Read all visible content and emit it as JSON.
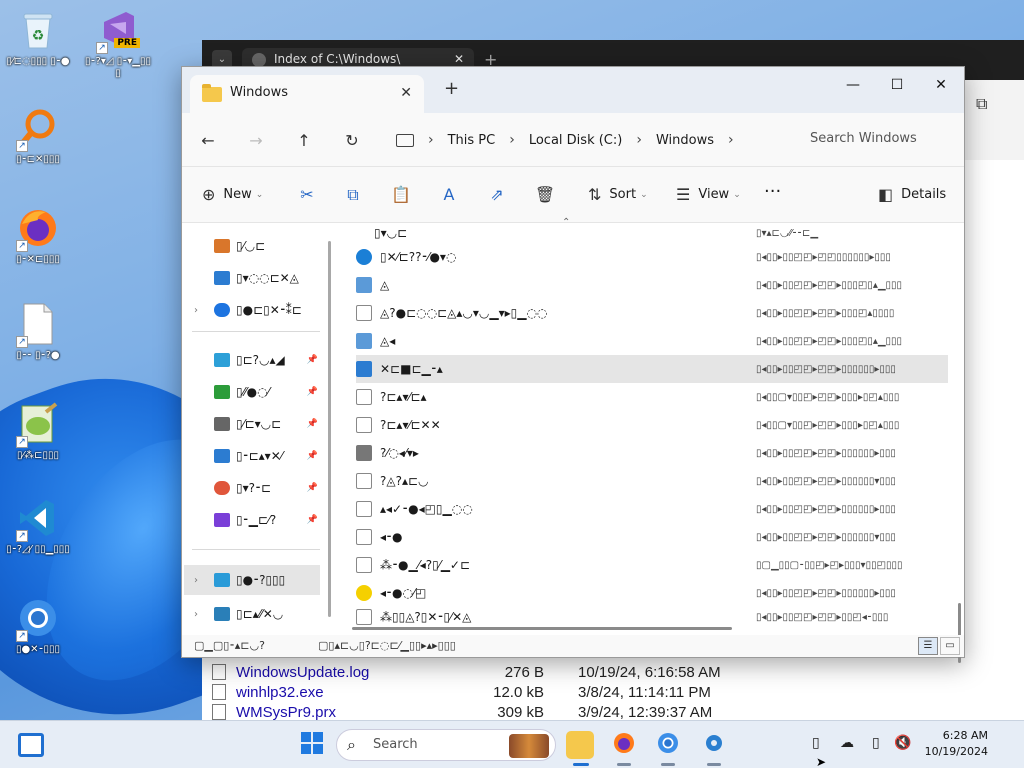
{
  "desktop": {
    "icons": [
      {
        "name": "recycle-bin",
        "label": "▯⁄⊏◌▯▯▯ ▯⁃●"
      },
      {
        "name": "visual-studio-pre",
        "label": "▯⁃?▾◿ ▯⁃▾▁▯▯▯",
        "badge": "PRE"
      },
      {
        "name": "search-everything",
        "label": "▯⁃⊏✕▯▯▯"
      },
      {
        "name": "firefox",
        "label": "▯⁃✕⊏▯▯▯"
      },
      {
        "name": "blank-file",
        "label": "▯⁃⁃ ▯⁃?●"
      },
      {
        "name": "notepad-plus",
        "label": "▯⁄⁂⊏▯▯▯"
      },
      {
        "name": "vscode",
        "label": "▯⁃?◿⁄ ▯▯▁▯▯▯"
      },
      {
        "name": "chrome",
        "label": "▯●✕⁃▯▯▯"
      }
    ]
  },
  "browser": {
    "tab_title": "Index of C:\\Windows\\",
    "files": [
      {
        "name": "WindowsUpdate.log",
        "size": "276 B",
        "date": "10/19/24, 6:16:58 AM"
      },
      {
        "name": "winhlp32.exe",
        "size": "12.0 kB",
        "date": "3/8/24, 11:14:11 PM"
      },
      {
        "name": "WMSysPr9.prx",
        "size": "309 kB",
        "date": "3/9/24, 12:39:37 AM"
      }
    ]
  },
  "explorer": {
    "tab_title": "Windows",
    "breadcrumb": [
      "This PC",
      "Local Disk (C:)",
      "Windows"
    ],
    "search_placeholder": "Search Windows",
    "commands": {
      "new": "New",
      "sort": "Sort",
      "view": "View",
      "more": "···",
      "details": "Details"
    },
    "nav": [
      {
        "label": "▯⁄◡⊏",
        "color": "#d9762b"
      },
      {
        "label": "▯▾◌◌⊏✕◬",
        "color": "#2c7cd1"
      },
      {
        "label": "▯●⊏▯✕⁃⁑⊏",
        "color": "#1d74e0"
      },
      {
        "label": "▯⊏?◡▴◢",
        "color": "#2da0d8"
      },
      {
        "label": "▯⁄⁄●◌⁄",
        "color": "#2c9c3a"
      },
      {
        "label": "▯⁄⊏▾◡⊏",
        "color": "#666"
      },
      {
        "label": "▯⁃⊏▴▾✕⁄",
        "color": "#2c7cd1"
      },
      {
        "label": "▯▾?⁃⊏",
        "color": "#e0563b"
      },
      {
        "label": "▯⁃▁⊏⁄?",
        "color": "#7a3fd8"
      },
      {
        "label": "▯●⁃?▯▯▯",
        "color": "#2a9bd8"
      },
      {
        "label": "▯⊏▴⁄⁄✕◡",
        "color": "#2a7fb8"
      }
    ],
    "files": [
      {
        "name": "▯▾◡⊏",
        "details": "▯▾▴⊏◡⁄⁄⁃⁃⊏▁",
        "icon": "folder"
      },
      {
        "name": "▯✕⁄⊏??⁃⁄●▾◌",
        "details": "▯◂▯▯▸▯▯◰◰▸◰◰▯▯▯▯▯▯▸▯▯▯",
        "icon": "edge"
      },
      {
        "name": "◬",
        "details": "▯◂▯▯▸▯▯◰◰▸◰◰▸▯▯▯◰▯▴▁▯▯▯",
        "icon": "image"
      },
      {
        "name": "◬?●⊏◌◌⊏◬▴◡▾◡▁▾▸▯▁◌◌",
        "details": "▯◂▯▯▸▯▯◰◰▸◰◰▸▯▯▯◰▴▯▯▯▯",
        "icon": "doc"
      },
      {
        "name": "◬◂",
        "details": "▯◂▯▯▸▯▯◰◰▸◰◰▸▯▯▯◰▯▴▁▯▯▯",
        "icon": "image"
      },
      {
        "name": "✕⊏■⊏▁⁃▴",
        "details": "▯◂▯▯▸▯▯◰◰▸◰◰▸▯▯▯▯▯▯▸▯▯▯",
        "icon": "app",
        "selected": true
      },
      {
        "name": "?⊏▴▾⁄⊏▴",
        "details": "▯◂▯▯▢▾▯▯◰▸◰◰▸▯▯▯▸▯◰▴▯▯▯",
        "icon": "text"
      },
      {
        "name": "?⊏▴▾⁄⊏✕✕",
        "details": "▯◂▯▯▢▾▯▯◰▸◰◰▸▯▯▯▸▯◰▴▯▯▯",
        "icon": "text"
      },
      {
        "name": "?⁄◌◂⁄▾▸",
        "details": "▯◂▯▯▸▯▯◰◰▸◰◰▸▯▯▯▯▯▯▸▯▯▯",
        "icon": "printer"
      },
      {
        "name": "?◬?▴⊏◡",
        "details": "▯◂▯▯▸▯▯◰◰▸◰◰▸▯▯▯▯▯▯▾▯▯▯",
        "icon": "doc"
      },
      {
        "name": "▴◂✓⁃●◂◰▯▁◌◌",
        "details": "▯◂▯▯▸▯▯◰◰▸◰◰▸▯▯▯▯▯▯▸▯▯▯",
        "icon": "doc"
      },
      {
        "name": "◂⁃●",
        "details": "▯◂▯▯▸▯▯◰◰▸◰◰▸▯▯▯▯▯▯▾▯▯▯",
        "icon": "doc"
      },
      {
        "name": "⁂⁃●▁⁄◂?▯⁄▁✓⊏",
        "details": "▯▢▁▯▯▢⁃▯▯◰▸◰▸▯▯▯▾▯▯◰▯▯▯",
        "icon": "doc"
      },
      {
        "name": "◂⁃●◌⁄◰",
        "details": "▯◂▯▯▸▯▯◰◰▸◰◰▸▯▯▯▯▯▯▸▯▯▯",
        "icon": "help"
      },
      {
        "name": "⁂▯▯◬?▯✕⁃▯⁄✕◬",
        "details": "▯◂▯▯▸▯▯◰◰▸◰◰▸▯▯◰◂⁃▯▯▯",
        "icon": "blank"
      }
    ],
    "status": {
      "count": "▢▁▢▯⁃▴⊏◡?",
      "selected": "▢▯▴⊏◡▯?⊏◌⊏⁄▁▯▯▸▴▸▯▯▯"
    }
  },
  "taskbar": {
    "search_label": "Search",
    "time": "6:28 AM",
    "date": "10/19/2024"
  }
}
